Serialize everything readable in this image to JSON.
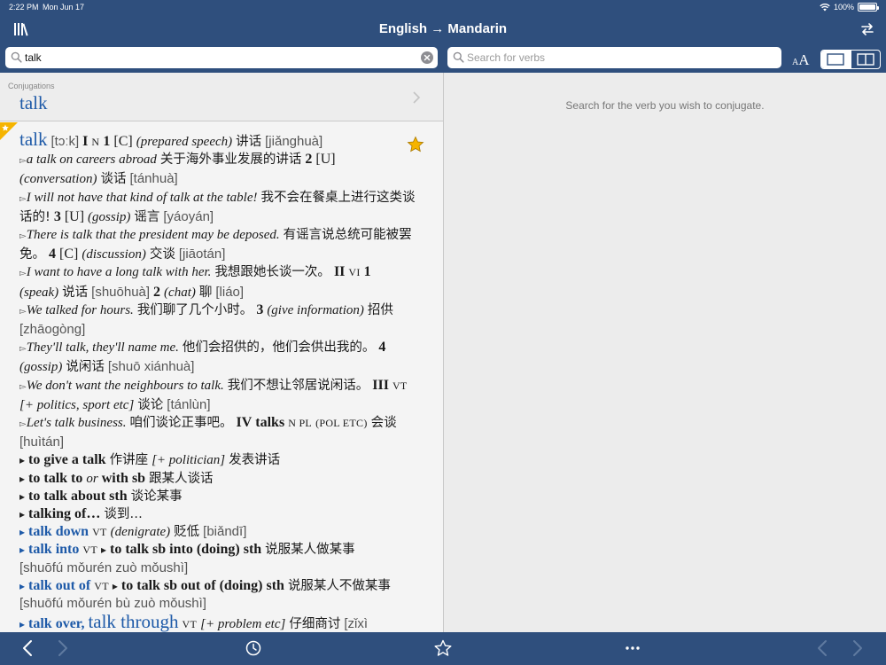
{
  "status_bar": {
    "time": "2:22 PM",
    "date": "Mon Jun 17",
    "battery": "100%"
  },
  "nav": {
    "title": "English → Mandarin"
  },
  "search": {
    "query": "talk",
    "verbs_placeholder": "Search for verbs"
  },
  "font_size": {
    "small": "A",
    "big": "A"
  },
  "conjugations": {
    "label": "Conjugations",
    "word": "talk"
  },
  "right_pane": {
    "hint": "Search for the verb you wish to conjugate."
  },
  "entry": {
    "headword": "talk",
    "pronunciation": "[tɔːk]",
    "t": {
      "1": "I",
      "2": "N",
      "3": "1",
      "4": "[C]",
      "5": "(prepared speech)",
      "6": "讲话",
      "7": "[jiǎnghuà]",
      "8": "▻",
      "9": "a talk on careers abroad",
      "10": "关于海外事业发展的讲话",
      "11": "2",
      "12": "[U]",
      "13": "(conversation)",
      "14": "谈话",
      "15": "[tánhuà]",
      "16": "▻",
      "17": "I will not have that kind of talk at the table!",
      "18": "我不会在餐桌上进行这类谈话的!",
      "19": "3",
      "20": "[U]",
      "21": "(gossip)",
      "22": "谣言",
      "23": "[yáoyán]",
      "24": "▻",
      "25": "There is talk that the president may be deposed.",
      "26": "有谣言说总统可能被罢免。",
      "27": "4",
      "28": "[C]",
      "29": "(discussion)",
      "30": "交谈",
      "31": "[jiāotán]",
      "32": "▻",
      "33": "I want to have a long talk with her.",
      "34": "我想跟她长谈一次。",
      "35": "II",
      "36": "VI",
      "37": "1",
      "38": "(speak)",
      "39": "说话",
      "40": "[shuōhuà]",
      "41": "2",
      "42": "(chat)",
      "43": "聊",
      "44": "[liáo]",
      "45": "▻",
      "46": "We talked for hours.",
      "47": "我们聊了几个小时。",
      "48": "3",
      "49": "(give information)",
      "50": "招供",
      "51": "[zhāogòng]",
      "52": "▻",
      "53": "They'll talk, they'll name me.",
      "54": "他们会招供的，他们会供出我的。",
      "55": "4",
      "56": "(gossip)",
      "57": "说闲话",
      "58": "[shuō xiánhuà]",
      "59": "▻",
      "60": "We don't want the neighbours to talk.",
      "61": "我们不想让邻居说闲话。",
      "62": "III",
      "63": "VT",
      "64": "[+ politics, sport etc]",
      "65": "谈论",
      "66": "[tánlùn]",
      "67": "▻",
      "68": "Let's talk business.",
      "69": "咱们谈论正事吧。",
      "70": "IV",
      "71": "talks",
      "72": "N PL",
      "73": "(POL ETC)",
      "74": "会谈",
      "75": "[huìtán]",
      "76": "▸",
      "77": "to give a talk",
      "78": "作讲座",
      "79": "[+ politician]",
      "80": "发表讲话",
      "81": "▸",
      "82": "to talk",
      "83": "to",
      "84": "or",
      "85": "with",
      "86": "sb",
      "87": "跟某人谈话",
      "88": "▸",
      "89": "to talk about sth",
      "90": "谈论某事",
      "91": "▸",
      "92": "talking of…",
      "93": "谈到…",
      "94": "▸",
      "95": "talk down",
      "96": "VT",
      "97": "(denigrate)",
      "98": "贬低",
      "99": "[biǎndī]",
      "100": "▸",
      "101": "talk into",
      "102": "VT",
      "103": "▸",
      "104": "to talk sb into (doing) sth",
      "105": "说服某人做某事",
      "106": "[shuōfú mǒurén zuò mǒushì]",
      "107": "▸",
      "108": "talk out of",
      "109": "VT",
      "110": "▸",
      "111": "to talk sb out of (doing) sth",
      "112": "说服某人不做某事",
      "113": "[shuōfú mǒurén bù zuò mǒushì]",
      "114": "▸",
      "115": "talk over,",
      "116": "talk through",
      "117": "VT",
      "118": "[+ problem etc]",
      "119": "仔细商讨",
      "120": "[zǐxì shāngtǎo]"
    }
  },
  "colors": {
    "header": "#2f4f7d",
    "link_blue": "#1e5aa8",
    "star": "#f5b400"
  }
}
